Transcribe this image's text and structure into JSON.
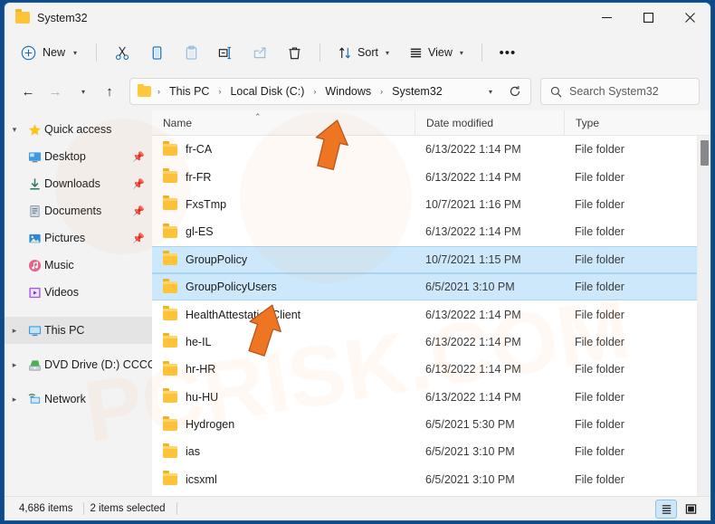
{
  "window": {
    "title": "System32",
    "icon": "folder-icon",
    "controls": {
      "minimize": "—",
      "maximize": "☐",
      "close": "✕"
    }
  },
  "toolbar": {
    "new_label": "New",
    "new_icon": "plus-circle-icon",
    "cut_icon": "scissors-icon",
    "copy_icon": "copy-icon",
    "paste_icon": "paste-icon",
    "rename_icon": "rename-icon",
    "share_icon": "share-icon",
    "delete_icon": "trash-icon",
    "sort_label": "Sort",
    "sort_icon": "sort-arrows-icon",
    "view_label": "View",
    "view_icon": "list-lines-icon",
    "more_label": "•••"
  },
  "address": {
    "back_icon": "←",
    "forward_icon": "→",
    "recent_icon": "⌄",
    "up_icon": "↑",
    "folder_icon": "folder-icon",
    "breadcrumbs": [
      "This PC",
      "Local Disk (C:)",
      "Windows",
      "System32"
    ],
    "separator": "›",
    "dropdown_icon": "⌄",
    "refresh_icon": "↻"
  },
  "search": {
    "icon": "search-icon",
    "placeholder": "Search System32",
    "value": ""
  },
  "sidebar": {
    "items": [
      {
        "label": "Quick access",
        "icon": "star-icon",
        "expander": "⌄",
        "indent": false,
        "pinned": false,
        "selected": false
      },
      {
        "label": "Desktop",
        "icon": "desktop-icon",
        "expander": "",
        "indent": true,
        "pinned": true,
        "selected": false
      },
      {
        "label": "Downloads",
        "icon": "download-icon",
        "expander": "",
        "indent": true,
        "pinned": true,
        "selected": false
      },
      {
        "label": "Documents",
        "icon": "document-icon",
        "expander": "",
        "indent": true,
        "pinned": true,
        "selected": false
      },
      {
        "label": "Pictures",
        "icon": "picture-icon",
        "expander": "",
        "indent": true,
        "pinned": true,
        "selected": false
      },
      {
        "label": "Music",
        "icon": "music-icon",
        "expander": "",
        "indent": true,
        "pinned": false,
        "selected": false
      },
      {
        "label": "Videos",
        "icon": "video-icon",
        "expander": "",
        "indent": true,
        "pinned": false,
        "selected": false
      },
      {
        "label": "This PC",
        "icon": "pc-icon",
        "expander": "›",
        "indent": false,
        "pinned": false,
        "selected": true
      },
      {
        "label": "DVD Drive (D:) CCCC",
        "icon": "dvd-icon",
        "expander": "›",
        "indent": false,
        "pinned": false,
        "selected": false
      },
      {
        "label": "Network",
        "icon": "network-icon",
        "expander": "›",
        "indent": false,
        "pinned": false,
        "selected": false
      }
    ]
  },
  "filelist": {
    "columns": [
      {
        "label": "Name",
        "sorted": true,
        "sort_indicator": "⌃"
      },
      {
        "label": "Date modified",
        "sorted": false,
        "sort_indicator": ""
      },
      {
        "label": "Type",
        "sorted": false,
        "sort_indicator": ""
      }
    ],
    "rows": [
      {
        "name": "fr-CA",
        "date": "6/13/2022 1:14 PM",
        "type": "File folder",
        "selected": false
      },
      {
        "name": "fr-FR",
        "date": "6/13/2022 1:14 PM",
        "type": "File folder",
        "selected": false
      },
      {
        "name": "FxsTmp",
        "date": "10/7/2021 1:16 PM",
        "type": "File folder",
        "selected": false
      },
      {
        "name": "gl-ES",
        "date": "6/13/2022 1:14 PM",
        "type": "File folder",
        "selected": false
      },
      {
        "name": "GroupPolicy",
        "date": "10/7/2021 1:15 PM",
        "type": "File folder",
        "selected": true
      },
      {
        "name": "GroupPolicyUsers",
        "date": "6/5/2021 3:10 PM",
        "type": "File folder",
        "selected": true
      },
      {
        "name": "HealthAttestationClient",
        "date": "6/13/2022 1:14 PM",
        "type": "File folder",
        "selected": false
      },
      {
        "name": "he-IL",
        "date": "6/13/2022 1:14 PM",
        "type": "File folder",
        "selected": false
      },
      {
        "name": "hr-HR",
        "date": "6/13/2022 1:14 PM",
        "type": "File folder",
        "selected": false
      },
      {
        "name": "hu-HU",
        "date": "6/13/2022 1:14 PM",
        "type": "File folder",
        "selected": false
      },
      {
        "name": "Hydrogen",
        "date": "6/5/2021 5:30 PM",
        "type": "File folder",
        "selected": false
      },
      {
        "name": "ias",
        "date": "6/5/2021 3:10 PM",
        "type": "File folder",
        "selected": false
      },
      {
        "name": "icsxml",
        "date": "6/5/2021 3:10 PM",
        "type": "File folder",
        "selected": false
      }
    ]
  },
  "statusbar": {
    "item_count": "4,686 items",
    "selection": "2 items selected",
    "details_view_icon": "details-view-icon",
    "large_icons_view_icon": "large-icons-view-icon"
  },
  "colors": {
    "window_border": "#1763ab",
    "selection": "#cde8fa",
    "selection_border": "#a8d5f2",
    "accent_blue": "#0f6cbd",
    "folder_yellow": "#fdc43a",
    "arrow_orange": "#ee7623",
    "chrome": "#f3f3f3"
  },
  "annotations": {
    "arrow1": "orange-arrow-pointing-to-column-header",
    "arrow2": "orange-arrow-pointing-to-selected-rows"
  },
  "watermark": {
    "text": "PCRISK.COM"
  }
}
